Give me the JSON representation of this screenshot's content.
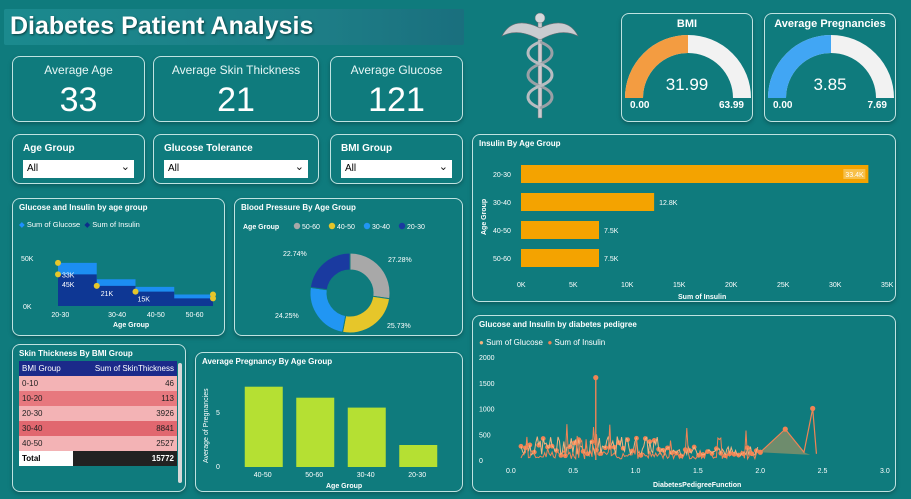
{
  "header": {
    "title": "Diabetes Patient Analysis"
  },
  "kpis": [
    {
      "label": "Average Age",
      "value": "33"
    },
    {
      "label": "Average Skin Thickness",
      "value": "21"
    },
    {
      "label": "Average Glucose",
      "value": "121"
    }
  ],
  "gauges": {
    "bmi": {
      "title": "BMI",
      "value": "31.99",
      "min": "0.00",
      "max": "63.99",
      "fraction": 0.5,
      "color": "#f39c41"
    },
    "pregnancies": {
      "title": "Average Pregnancies",
      "value": "3.85",
      "min": "0.00",
      "max": "7.69",
      "fraction": 0.5,
      "color": "#41a6f4"
    }
  },
  "slicers": [
    {
      "label": "Age Group",
      "value": "All"
    },
    {
      "label": "Glucose Tolerance",
      "value": "All"
    },
    {
      "label": "BMI Group",
      "value": "All"
    }
  ],
  "colors": {
    "orange": "#f4a300",
    "lime": "#b5e033",
    "salmon": "#f0906a",
    "accent": "#0f7b7d"
  },
  "chart_data": [
    {
      "id": "glucose_insulin_age",
      "type": "area",
      "title": "Glucose and Insulin by age group",
      "categories": [
        "20-30",
        "30-40",
        "40-50",
        "50-60"
      ],
      "series": [
        {
          "name": "Sum of Glucose",
          "values": [
            45000,
            28000,
            20000,
            12000
          ],
          "color": "#1e90ff"
        },
        {
          "name": "Sum of Insulin",
          "values": [
            33000,
            21000,
            15000,
            8000
          ],
          "color": "#0d2e8a"
        }
      ],
      "data_labels": [
        "33K",
        "45K",
        "21K",
        "15K"
      ],
      "yticks": [
        "0K",
        "50K"
      ],
      "xlabel": "Age Group"
    },
    {
      "id": "bp_age",
      "type": "pie",
      "title": "Blood Pressure By Age Group",
      "legend_title": "Age Group",
      "slices": [
        {
          "name": "50-60",
          "value": 27.28,
          "label": "27.28%",
          "color": "#a8a8a8"
        },
        {
          "name": "40-50",
          "value": 25.73,
          "label": "25.73%",
          "color": "#e6c62a"
        },
        {
          "name": "30-40",
          "value": 24.25,
          "label": "24.25%",
          "color": "#2196f3"
        },
        {
          "name": "20-30",
          "value": 22.74,
          "label": "22.74%",
          "color": "#1a3aa0"
        }
      ]
    },
    {
      "id": "insulin_age",
      "type": "bar",
      "title": "Insulin By Age Group",
      "categories": [
        "20-30",
        "30-40",
        "40-50",
        "50-60"
      ],
      "values": [
        33400,
        12800,
        7500,
        7500
      ],
      "value_labels": [
        "33.4K",
        "12.8K",
        "7.5K",
        "7.5K"
      ],
      "xticks": [
        "0K",
        "5K",
        "10K",
        "15K",
        "20K",
        "25K",
        "30K",
        "35K"
      ],
      "xlim": [
        0,
        35000
      ],
      "xlabel": "Sum of Insulin",
      "ylabel": "Age Group"
    },
    {
      "id": "preg_age",
      "type": "bar",
      "title": "Average Pregnancy By Age Group",
      "categories": [
        "40-50",
        "50-60",
        "30-40",
        "20-30"
      ],
      "values": [
        7.3,
        6.3,
        5.4,
        2.0
      ],
      "yticks": [
        "0",
        "5"
      ],
      "ylim": [
        0,
        8
      ],
      "xlabel": "Age Group",
      "ylabel": "Average of Pregnancies"
    },
    {
      "id": "glucose_insulin_pedigree",
      "type": "line",
      "title": "Glucose and Insulin by diabetes pedigree",
      "series": [
        {
          "name": "Sum of Glucose",
          "color": "#f4b27e"
        },
        {
          "name": "Sum of Insulin",
          "color": "#f08455"
        }
      ],
      "yticks": [
        "0",
        "500",
        "1000",
        "1500",
        "2000"
      ],
      "xticks": [
        "0.0",
        "0.5",
        "1.0",
        "1.5",
        "2.0",
        "2.5",
        "3.0"
      ],
      "ylim": [
        0,
        2000
      ],
      "xlim": [
        0,
        3
      ],
      "xlabel": "DiabetesPedigreeFunction"
    }
  ],
  "skin_table": {
    "title": "Skin Thickness By BMI Group",
    "headers": [
      "BMI Group",
      "Sum of SkinThickness"
    ],
    "rows": [
      [
        "0-10",
        "46"
      ],
      [
        "10-20",
        "113"
      ],
      [
        "20-30",
        "3926"
      ],
      [
        "30-40",
        "8841"
      ],
      [
        "40-50",
        "2527"
      ]
    ],
    "total": [
      "Total",
      "15772"
    ]
  }
}
